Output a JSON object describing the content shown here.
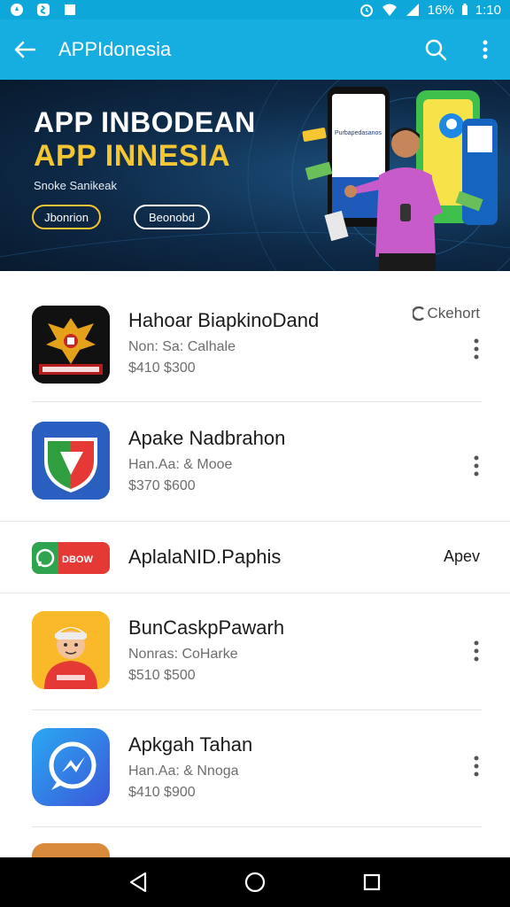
{
  "status_bar": {
    "battery": "16%",
    "time": "1:10",
    "icons": [
      "notification-icon",
      "shazam-icon",
      "square-notification-icon",
      "alarm-icon",
      "wifi-icon",
      "signal-icon"
    ]
  },
  "app_bar": {
    "title": "APPIdonesia",
    "icons": [
      "back-arrow-icon",
      "search-icon",
      "more-vert-icon"
    ]
  },
  "banner": {
    "headline_1": "APP INBODEAN",
    "headline_2": "APP INNESIA",
    "subtitle": "Snoke Sanikeak",
    "primary_button": "Jbonrion",
    "secondary_button": "Beonobd",
    "phone_screen_text": "Purbapedasanos",
    "colors": {
      "headline_2": "#f5c631",
      "background": "#0e2a48"
    }
  },
  "apps": [
    {
      "name": "Hahoar BiapkinoDand",
      "meta": "Non: Sa: Calhale",
      "price": "$410 $300",
      "badge": "Ckehort"
    },
    {
      "name": "Apake Nadbrahon",
      "meta": "Han.Aa: & Mooe",
      "price": "$370 $600"
    },
    {
      "name": "BunCaskpPawarh",
      "meta": "Nonras: CoHarke",
      "price": "$510 $500"
    },
    {
      "name": "Apkgah Tahan",
      "meta": "Han.Aa: & Nnoga",
      "price": "$410 $900"
    }
  ],
  "promo": {
    "icon_label": "DBOW",
    "name": "AplalaNID.Paphis",
    "action": "Apev"
  },
  "nav_bar": {
    "icons": [
      "back-triangle-icon",
      "home-circle-icon",
      "recents-square-icon"
    ]
  }
}
